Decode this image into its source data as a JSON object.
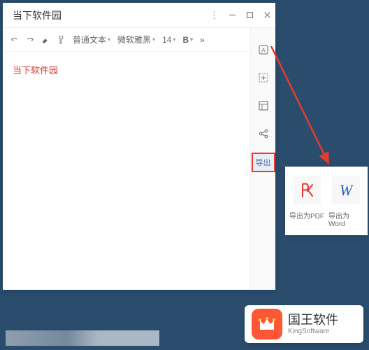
{
  "window": {
    "title": "当下软件园"
  },
  "toolbar": {
    "textStyle": "普通文本",
    "font": "微软雅黑",
    "fontSize": "14",
    "bold": "B"
  },
  "editor": {
    "content": "当下软件园"
  },
  "sidebar": {
    "exportLabel": "导出"
  },
  "exportPanel": {
    "pdfLabel": "导出为PDF",
    "wordLabel": "导出为Word",
    "wordLetter": "W"
  },
  "logo": {
    "cn": "国王软件",
    "en": "KingSoftware"
  }
}
